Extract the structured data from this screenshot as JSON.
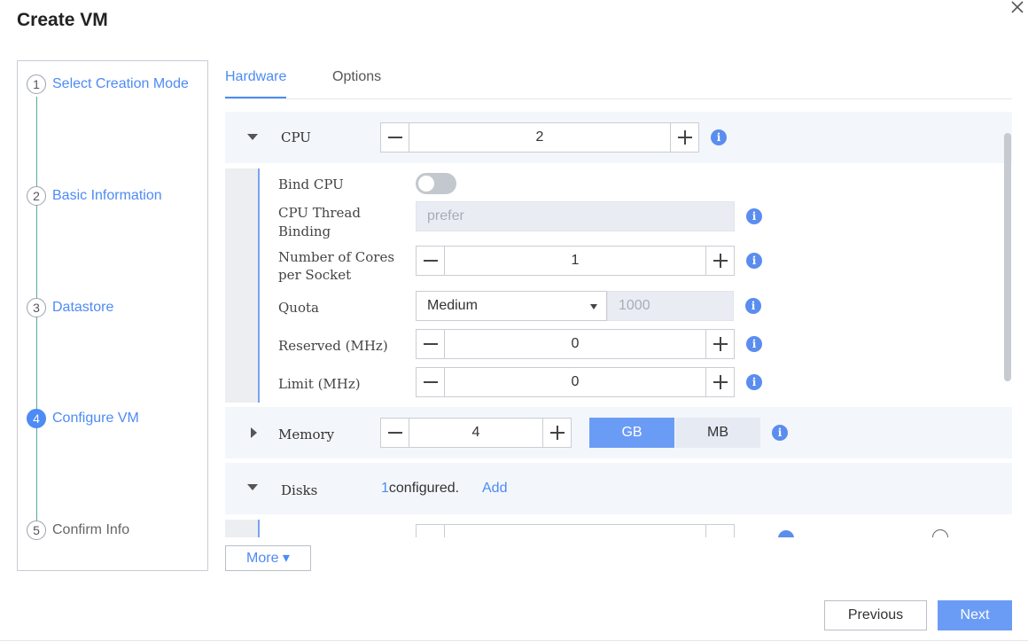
{
  "dialog": {
    "title": "Create VM"
  },
  "steps": [
    {
      "num": "1",
      "label": "Select Creation Mode"
    },
    {
      "num": "2",
      "label": "Basic Information"
    },
    {
      "num": "3",
      "label": "Datastore"
    },
    {
      "num": "4",
      "label": "Configure VM"
    },
    {
      "num": "5",
      "label": "Confirm Info"
    }
  ],
  "tabs": [
    {
      "label": "Hardware"
    },
    {
      "label": "Options"
    }
  ],
  "cpu": {
    "label": "CPU",
    "value": "2",
    "bind_cpu_label": "Bind CPU",
    "thread_binding_label_1": "CPU Thread",
    "thread_binding_label_2": "Binding",
    "thread_binding_placeholder": "prefer",
    "cores_label_1": "Number of Cores",
    "cores_label_2": "per Socket",
    "cores_value": "1",
    "quota_label": "Quota",
    "quota_selected": "Medium",
    "quota_value_placeholder": "1000",
    "reserved_label": "Reserved (MHz)",
    "reserved_value": "0",
    "limit_label": "Limit (MHz)",
    "limit_value": "0"
  },
  "memory": {
    "label": "Memory",
    "value": "4",
    "unit_gb": "GB",
    "unit_mb": "MB"
  },
  "disks": {
    "label": "Disks",
    "count": "1",
    "configured_text": "configured.",
    "add_label": "Add"
  },
  "more_label": "More ▾",
  "footer": {
    "previous_label": "Previous",
    "next_label": "Next"
  },
  "icons": {
    "info": "i"
  }
}
